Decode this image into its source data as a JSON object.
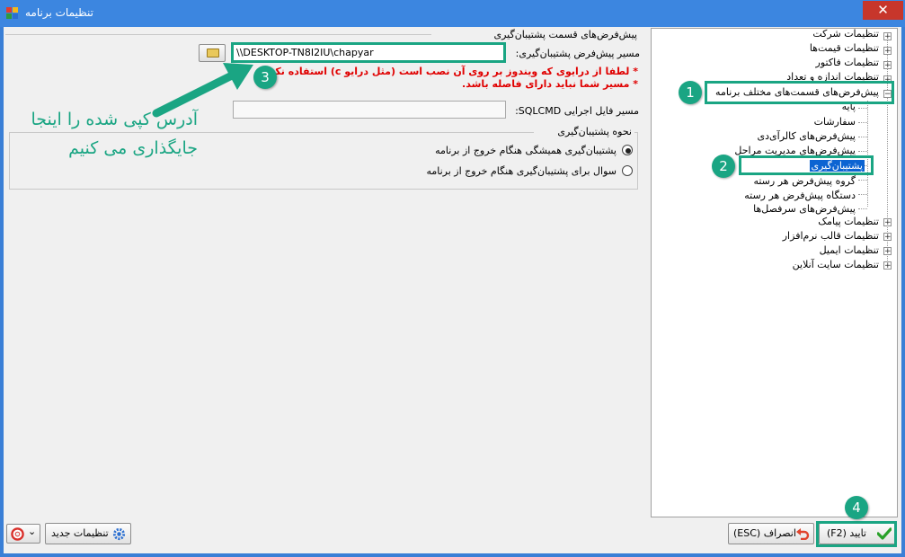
{
  "window": {
    "title": "تنظیمات برنامه",
    "close_glyph": "✕",
    "icons": {
      "app": "app-icon",
      "close": "close-icon"
    }
  },
  "backup": {
    "group_title": "پیش‌فرض‌های قسمت پشتیبان‌گیری",
    "path_label": "مسیر پیش‌فرض پشتیبان‌گیری:",
    "path_value": "\\\\DESKTOP-TN8I2IU\\chapyar",
    "warning_1": "* لطفا از درایوی که ویندوز بر روی آن نصب است (مثل درایو c) استفاده نکنید",
    "warning_2": "* مسیر شما نباید دارای فاصله باشد.",
    "sqlcmd_label": "مسیر فایل اجرایی SQLCMD:",
    "sqlcmd_value": "",
    "method_title": "نحوه پشتیبان‌گیری",
    "options": [
      {
        "label": "پشتیبان‌گیری همیشگی هنگام خروج از برنامه",
        "selected": true
      },
      {
        "label": "سوال برای پشتیبان‌گیری هنگام خروج از برنامه",
        "selected": false
      }
    ]
  },
  "tree": {
    "top_items": [
      {
        "label": "تنظیمات شرکت"
      },
      {
        "label": "تنظیمات قیمت‌ها"
      },
      {
        "label": "تنظیمات فاکتور"
      },
      {
        "label": "تنظیمات اندازه و تعداد"
      }
    ],
    "defaults_parent": "پیش‌فرض‌های قسمت‌های مختلف برنامه",
    "children": [
      "پایه",
      "سفارشات",
      "پیش‌فرض‌های کالرآی‌دی",
      "پیش‌فرض‌های مدیریت مراحل",
      "پشتیبان‌گیری",
      "گروه پیش‌فرض هر رسته",
      "دستگاه پیش‌فرض هر رسته",
      "پیش‌فرض‌های سرفصل‌ها"
    ],
    "bottom_items": [
      {
        "label": "تنظیمات پیامک"
      },
      {
        "label": "تنظیمات قالب نرم‌افزار"
      },
      {
        "label": "تنظیمات ایمیل"
      },
      {
        "label": "تنظیمات سایت آنلاین"
      }
    ],
    "expand_glyph": "+",
    "collapse_glyph": "−"
  },
  "buttons": {
    "confirm": "تایید (F2)",
    "cancel": "انصراف (ESC)",
    "new_settings": "تنظیمات جدید",
    "help_dropdown_glyph": "⌄",
    "icons": {
      "confirm": "checkmark-icon",
      "cancel": "undo-arrow-icon",
      "new_settings": "gear-icon",
      "help": "lifebuoy-icon"
    }
  },
  "annotations": {
    "badges": [
      "1",
      "2",
      "3",
      "4"
    ],
    "note_line_1": "آدرس کپی شده را اینجا",
    "note_line_2": "جایگذاری می کنیم",
    "color": "#1aa583"
  }
}
